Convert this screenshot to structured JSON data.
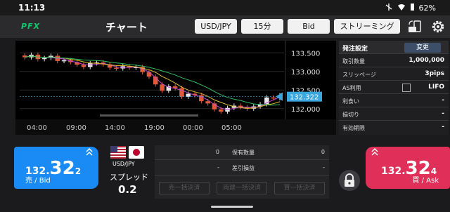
{
  "status_bar": {
    "time": "11:13",
    "battery": "62%"
  },
  "app": {
    "logo": "PFX",
    "title": "チャート"
  },
  "toolbar": {
    "pair": "USD/JPY",
    "timeframe": "15分",
    "side": "Bid",
    "mode": "ストリーミング"
  },
  "chart_data": {
    "type": "candlestick",
    "y_ticks": [
      "133.500",
      "133.000",
      "132.500",
      "132.000"
    ],
    "x_ticks": [
      "04:00",
      "09:00",
      "14:00",
      "19:00",
      "00:00",
      "05:00"
    ],
    "ylim": [
      131.75,
      133.75
    ],
    "current_price": "132.322",
    "closes": [
      133.38,
      133.45,
      133.33,
      133.36,
      133.42,
      133.28,
      133.3,
      133.25,
      133.18,
      133.12,
      133.22,
      133.24,
      133.19,
      133.1,
      133.08,
      133.14,
      133.1,
      133.12,
      132.98,
      132.86,
      132.65,
      132.48,
      132.6,
      132.55,
      132.32,
      132.4,
      132.36,
      132.2,
      132.14,
      131.98,
      131.92,
      132.02,
      132.08,
      132.04,
      132.0,
      132.06,
      132.12,
      132.3,
      132.28,
      132.36
    ]
  },
  "order_settings": {
    "title": "発注設定",
    "change_label": "変更",
    "rows": [
      {
        "label": "取引数量",
        "value": "1,000,000"
      },
      {
        "label": "スリッページ",
        "value": "3pips"
      },
      {
        "label": "AS利用",
        "value": "LIFO"
      },
      {
        "label": "利食い",
        "value": "-"
      },
      {
        "label": "損切り",
        "value": "-"
      },
      {
        "label": "有効期限",
        "value": "-"
      }
    ]
  },
  "sell": {
    "price_prefix": "132.",
    "price_main": "32",
    "price_suffix": "2",
    "label": "売 / Bid"
  },
  "buy": {
    "price_prefix": "132.",
    "price_main": "32",
    "price_suffix": "4",
    "label": "買 / Ask"
  },
  "pair_info": {
    "pair": "USD/JPY",
    "spread_label": "スプレッド",
    "spread_value": "0.2"
  },
  "position": {
    "rows": [
      {
        "left": "0",
        "label": "保有数量",
        "right": "0"
      },
      {
        "left": "-",
        "label": "差引損益",
        "right": "-"
      }
    ],
    "buttons": [
      "売一括決済",
      "両建一括決済",
      "買一括決済"
    ]
  },
  "colors": {
    "sell": "#1a8bf4",
    "buy": "#e0305a",
    "logo": "#12c86e",
    "price_marker": "#3aa6e0"
  }
}
